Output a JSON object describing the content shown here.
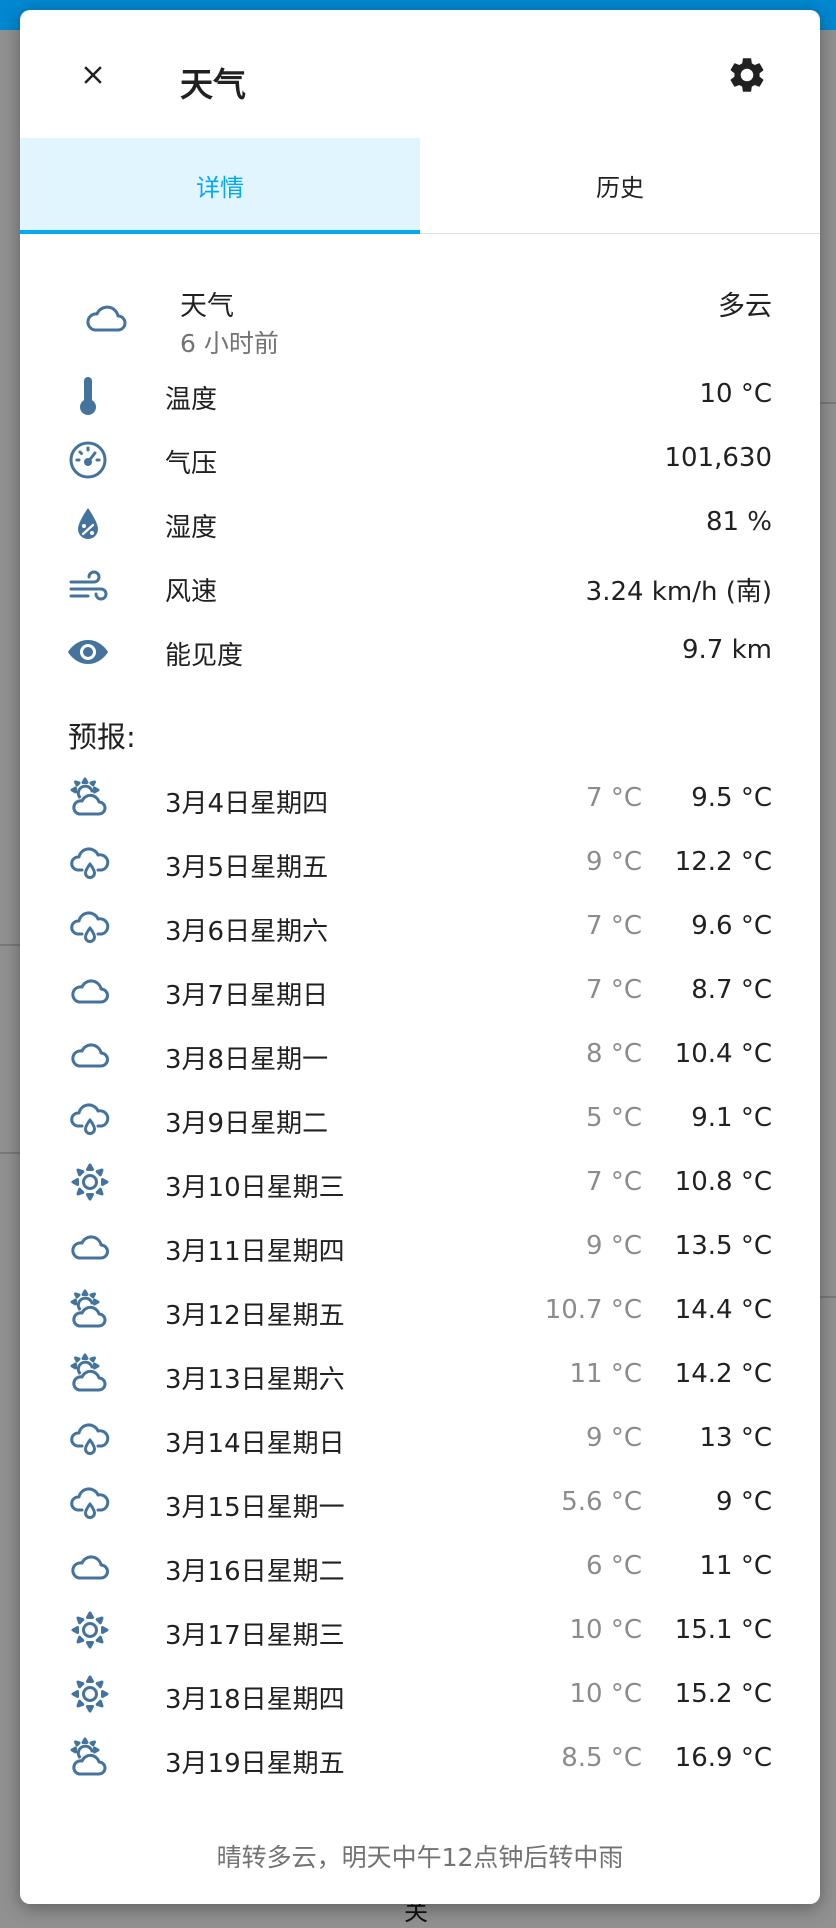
{
  "dialog": {
    "title": "天气",
    "tabs": [
      {
        "label": "详情",
        "active": true
      },
      {
        "label": "历史",
        "active": false
      }
    ]
  },
  "current": {
    "name": "天气",
    "last_changed": "6 小时前",
    "state": "多云",
    "icon": "cloudy-icon"
  },
  "attributes": [
    {
      "icon": "thermometer-icon",
      "label": "温度",
      "value": "10 °C"
    },
    {
      "icon": "gauge-icon",
      "label": "气压",
      "value": "101,630"
    },
    {
      "icon": "humidity-icon",
      "label": "湿度",
      "value": "81 %"
    },
    {
      "icon": "wind-icon",
      "label": "风速",
      "value": "3.24 km/h (南)"
    },
    {
      "icon": "eye-icon",
      "label": "能见度",
      "value": "9.7 km"
    }
  ],
  "forecast_title": "预报:",
  "forecast": [
    {
      "icon": "partly-cloudy-icon",
      "date": "3月4日星期四",
      "low": "7 °C",
      "high": "9.5 °C"
    },
    {
      "icon": "rainy-icon",
      "date": "3月5日星期五",
      "low": "9 °C",
      "high": "12.2 °C"
    },
    {
      "icon": "rainy-icon",
      "date": "3月6日星期六",
      "low": "7 °C",
      "high": "9.6 °C"
    },
    {
      "icon": "cloudy-icon",
      "date": "3月7日星期日",
      "low": "7 °C",
      "high": "8.7 °C"
    },
    {
      "icon": "cloudy-icon",
      "date": "3月8日星期一",
      "low": "8 °C",
      "high": "10.4 °C"
    },
    {
      "icon": "rainy-icon",
      "date": "3月9日星期二",
      "low": "5 °C",
      "high": "9.1 °C"
    },
    {
      "icon": "sunny-icon",
      "date": "3月10日星期三",
      "low": "7 °C",
      "high": "10.8 °C"
    },
    {
      "icon": "cloudy-icon",
      "date": "3月11日星期四",
      "low": "9 °C",
      "high": "13.5 °C"
    },
    {
      "icon": "partly-cloudy-icon",
      "date": "3月12日星期五",
      "low": "10.7 °C",
      "high": "14.4 °C"
    },
    {
      "icon": "partly-cloudy-icon",
      "date": "3月13日星期六",
      "low": "11 °C",
      "high": "14.2 °C"
    },
    {
      "icon": "rainy-icon",
      "date": "3月14日星期日",
      "low": "9 °C",
      "high": "13 °C"
    },
    {
      "icon": "rainy-icon",
      "date": "3月15日星期一",
      "low": "5.6 °C",
      "high": "9 °C"
    },
    {
      "icon": "cloudy-icon",
      "date": "3月16日星期二",
      "low": "6 °C",
      "high": "11 °C"
    },
    {
      "icon": "sunny-icon",
      "date": "3月17日星期三",
      "low": "10 °C",
      "high": "15.1 °C"
    },
    {
      "icon": "sunny-icon",
      "date": "3月18日星期四",
      "low": "10 °C",
      "high": "15.2 °C"
    },
    {
      "icon": "partly-cloudy-icon",
      "date": "3月19日星期五",
      "low": "8.5 °C",
      "high": "16.9 °C"
    }
  ],
  "attribution": "晴转多云，明天中午12点钟后转中雨",
  "background_peek_text": "关",
  "colors": {
    "accent": "#03a9f4",
    "icon": "#44739e",
    "secondary_text": "#737373"
  }
}
